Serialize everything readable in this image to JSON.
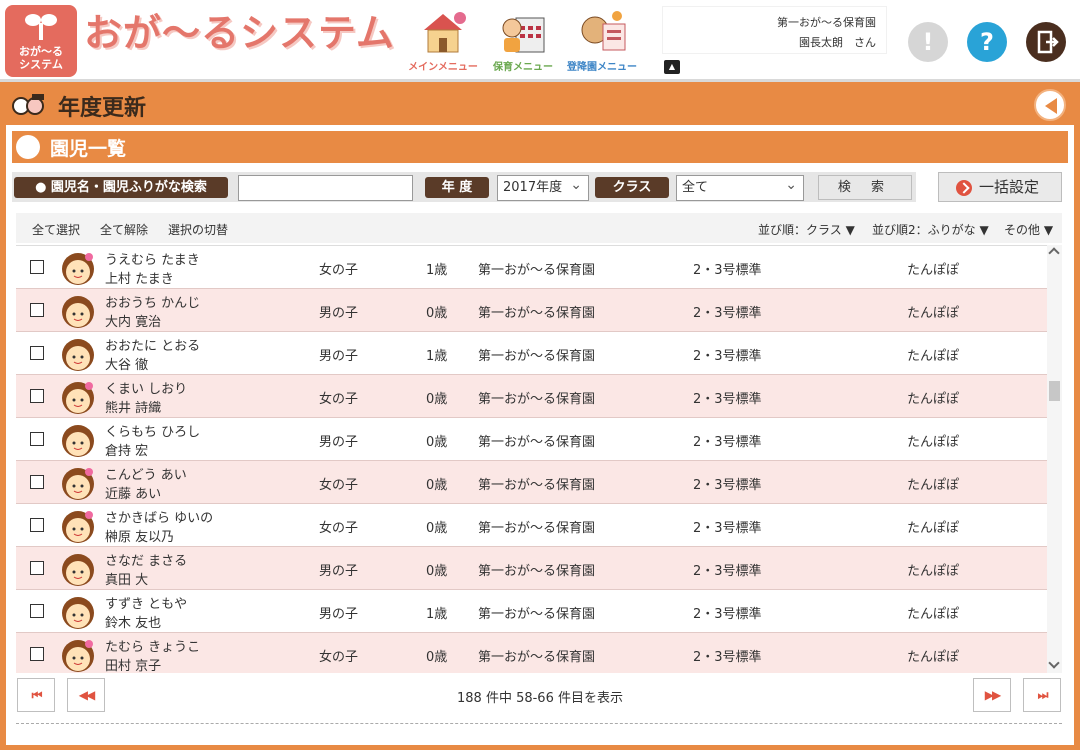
{
  "app": {
    "logo_text_1": "おが〜る",
    "logo_text_2": "システム",
    "title": "おが〜るシステム"
  },
  "menus": [
    {
      "label": "メインメニュー",
      "color": "#e46b5e"
    },
    {
      "label": "保育メニュー",
      "color": "#6aa84f"
    },
    {
      "label": "登降園メニュー",
      "color": "#3d85c6"
    }
  ],
  "user": {
    "facility": "第一おが〜る保育園",
    "name": "園長太朗　さん"
  },
  "header_icons": {
    "alert": "exclamation-icon",
    "help": "question-icon",
    "logout": "exit-door-icon"
  },
  "page": {
    "title": "年度更新"
  },
  "panel": {
    "title": "園児一覧"
  },
  "search": {
    "name_label": "● 園児名・園児ふりがな検索",
    "name_value": "",
    "year_label": "年 度",
    "year_value": "2017年度",
    "class_label": "クラス",
    "class_value": "全て",
    "search_button": "検 索",
    "bulk_button": "一括設定"
  },
  "toolbar": {
    "select_all": "全て選択",
    "deselect_all": "全て解除",
    "toggle_selection": "選択の切替",
    "sort1": "並び順：クラス ▼",
    "sort2": "並び順2：ふりがな ▼",
    "other": "その他 ▼"
  },
  "children": [
    {
      "kana": "うえむら たまき",
      "name": "上村 たまき",
      "gender": "女の子",
      "age": "1歳",
      "facility": "第一おが〜る保育園",
      "cert": "2・3号標準",
      "class": "たんぽぽ"
    },
    {
      "kana": "おおうち かんじ",
      "name": "大内 寛治",
      "gender": "男の子",
      "age": "0歳",
      "facility": "第一おが〜る保育園",
      "cert": "2・3号標準",
      "class": "たんぽぽ"
    },
    {
      "kana": "おおたに とおる",
      "name": "大谷 徹",
      "gender": "男の子",
      "age": "1歳",
      "facility": "第一おが〜る保育園",
      "cert": "2・3号標準",
      "class": "たんぽぽ"
    },
    {
      "kana": "くまい しおり",
      "name": "熊井 詩織",
      "gender": "女の子",
      "age": "0歳",
      "facility": "第一おが〜る保育園",
      "cert": "2・3号標準",
      "class": "たんぽぽ"
    },
    {
      "kana": "くらもち ひろし",
      "name": "倉持 宏",
      "gender": "男の子",
      "age": "0歳",
      "facility": "第一おが〜る保育園",
      "cert": "2・3号標準",
      "class": "たんぽぽ"
    },
    {
      "kana": "こんどう あい",
      "name": "近藤 あい",
      "gender": "女の子",
      "age": "0歳",
      "facility": "第一おが〜る保育園",
      "cert": "2・3号標準",
      "class": "たんぽぽ"
    },
    {
      "kana": "さかきばら ゆいの",
      "name": "榊原 友以乃",
      "gender": "女の子",
      "age": "0歳",
      "facility": "第一おが〜る保育園",
      "cert": "2・3号標準",
      "class": "たんぽぽ"
    },
    {
      "kana": "さなだ まさる",
      "name": "真田 大",
      "gender": "男の子",
      "age": "0歳",
      "facility": "第一おが〜る保育園",
      "cert": "2・3号標準",
      "class": "たんぽぽ"
    },
    {
      "kana": "すずき ともや",
      "name": "鈴木 友也",
      "gender": "男の子",
      "age": "1歳",
      "facility": "第一おが〜る保育園",
      "cert": "2・3号標準",
      "class": "たんぽぽ"
    },
    {
      "kana": "たむら きょうこ",
      "name": "田村 京子",
      "gender": "女の子",
      "age": "0歳",
      "facility": "第一おが〜る保育園",
      "cert": "2・3号標準",
      "class": "たんぽぽ"
    }
  ],
  "pager": {
    "first": "⏮",
    "prev": "◀◀",
    "next": "▶▶",
    "last": "⏭",
    "summary": "188 件中 58-66 件目を表示"
  }
}
